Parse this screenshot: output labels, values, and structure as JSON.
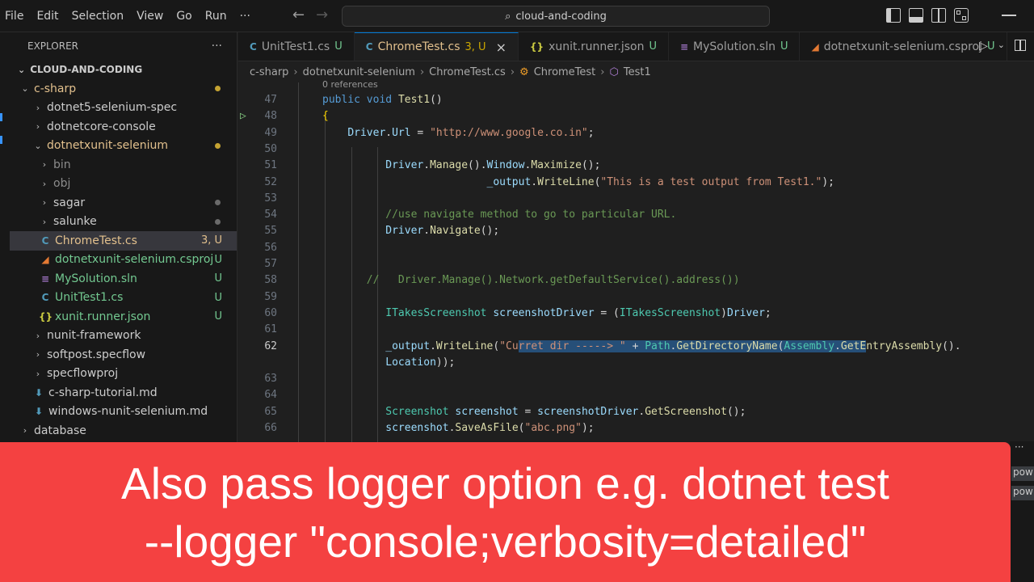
{
  "menu": [
    "File",
    "Edit",
    "Selection",
    "View",
    "Go",
    "Run",
    "···"
  ],
  "search": {
    "text": "cloud-and-coding"
  },
  "explorer": {
    "title": "EXPLORER",
    "more": "···",
    "root": "CLOUD-AND-CODING",
    "items": [
      {
        "label": "c-sharp",
        "indent": 1,
        "chev": "⌄",
        "icon": "",
        "color": "#e2c08d",
        "mark": "dot",
        "markColor": "#c5a332"
      },
      {
        "label": "dotnet5-selenium-spec",
        "indent": 2,
        "chev": "›",
        "icon": "",
        "color": "#cccccc",
        "mark": "",
        "markColor": ""
      },
      {
        "label": "dotnetcore-console",
        "indent": 2,
        "chev": "›",
        "icon": "",
        "color": "#cccccc",
        "mark": "",
        "markColor": ""
      },
      {
        "label": "dotnetxunit-selenium",
        "indent": 2,
        "chev": "⌄",
        "icon": "",
        "color": "#e2c08d",
        "mark": "dot",
        "markColor": "#c5a332"
      },
      {
        "label": "bin",
        "indent": 3,
        "chev": "›",
        "icon": "",
        "color": "#8c8c8c",
        "mark": "",
        "markColor": ""
      },
      {
        "label": "obj",
        "indent": 3,
        "chev": "›",
        "icon": "",
        "color": "#8c8c8c",
        "mark": "",
        "markColor": ""
      },
      {
        "label": "sagar",
        "indent": 3,
        "chev": "›",
        "icon": "",
        "color": "#cccccc",
        "mark": "dot",
        "markColor": "#6a6a6a"
      },
      {
        "label": "salunke",
        "indent": 3,
        "chev": "›",
        "icon": "",
        "color": "#cccccc",
        "mark": "dot",
        "markColor": "#6a6a6a"
      },
      {
        "label": "ChromeTest.cs",
        "indent": 3,
        "chev": "",
        "icon": "C",
        "iconColor": "#519aba",
        "color": "#e2c08d",
        "mark": "3, U",
        "markColor": "#e2c08d",
        "selected": true
      },
      {
        "label": "dotnetxunit-selenium.csproj",
        "indent": 3,
        "chev": "",
        "icon": "◢",
        "iconColor": "#e37933",
        "color": "#73c991",
        "mark": "U",
        "markColor": "#73c991"
      },
      {
        "label": "MySolution.sln",
        "indent": 3,
        "chev": "",
        "icon": "≡",
        "iconColor": "#a074c4",
        "color": "#73c991",
        "mark": "U",
        "markColor": "#73c991"
      },
      {
        "label": "UnitTest1.cs",
        "indent": 3,
        "chev": "",
        "icon": "C",
        "iconColor": "#519aba",
        "color": "#73c991",
        "mark": "U",
        "markColor": "#73c991"
      },
      {
        "label": "xunit.runner.json",
        "indent": 3,
        "chev": "",
        "icon": "{}",
        "iconColor": "#cbcb41",
        "color": "#73c991",
        "mark": "U",
        "markColor": "#73c991"
      },
      {
        "label": "nunit-framework",
        "indent": 2,
        "chev": "›",
        "icon": "",
        "color": "#cccccc",
        "mark": "",
        "markColor": ""
      },
      {
        "label": "softpost.specflow",
        "indent": 2,
        "chev": "›",
        "icon": "",
        "color": "#cccccc",
        "mark": "",
        "markColor": ""
      },
      {
        "label": "specflowproj",
        "indent": 2,
        "chev": "›",
        "icon": "",
        "color": "#cccccc",
        "mark": "",
        "markColor": ""
      },
      {
        "label": "c-sharp-tutorial.md",
        "indent": 2,
        "chev": "",
        "icon": "⬇",
        "iconColor": "#519aba",
        "color": "#cccccc",
        "mark": "",
        "markColor": ""
      },
      {
        "label": "windows-nunit-selenium.md",
        "indent": 2,
        "chev": "",
        "icon": "⬇",
        "iconColor": "#519aba",
        "color": "#cccccc",
        "mark": "",
        "markColor": ""
      },
      {
        "label": "database",
        "indent": 1,
        "chev": "›",
        "icon": "",
        "color": "#cccccc",
        "mark": "",
        "markColor": ""
      }
    ]
  },
  "tabs": [
    {
      "icon": "C",
      "iconColor": "#519aba",
      "label": "UnitTest1.cs",
      "mark": "U",
      "active": false
    },
    {
      "icon": "C",
      "iconColor": "#519aba",
      "label": "ChromeTest.cs",
      "mark": "3, U",
      "active": true
    },
    {
      "icon": "{}",
      "iconColor": "#cbcb41",
      "label": "xunit.runner.json",
      "mark": "U",
      "active": false
    },
    {
      "icon": "≡",
      "iconColor": "#a074c4",
      "label": "MySolution.sln",
      "mark": "U",
      "active": false
    },
    {
      "icon": "◢",
      "iconColor": "#e37933",
      "label": "dotnetxunit-selenium.csproj",
      "mark": "U",
      "active": false
    }
  ],
  "tab_close": "×",
  "breadcrumb": [
    "c-sharp",
    "dotnetxunit-selenium",
    "ChromeTest.cs",
    "ChromeTest",
    "Test1"
  ],
  "code": {
    "references": "0 references",
    "current_line": "62",
    "lines": [
      {
        "n": "47",
        "tokens": [
          [
            "kw",
            "public "
          ],
          [
            "kw",
            "void "
          ],
          [
            "fn",
            "Test1"
          ],
          [
            "pn",
            "()"
          ]
        ]
      },
      {
        "n": "48",
        "tokens": [
          [
            "brace",
            "{"
          ]
        ]
      },
      {
        "n": "49",
        "tokens": [
          [
            "pn",
            "    "
          ],
          [
            "id",
            "Driver"
          ],
          [
            "pn",
            "."
          ],
          [
            "id",
            "Url"
          ],
          [
            "pn",
            " = "
          ],
          [
            "str",
            "\"http://www.google.co.in\""
          ],
          [
            "pn",
            ";"
          ]
        ]
      },
      {
        "n": "50",
        "tokens": []
      },
      {
        "n": "51",
        "tokens": [
          [
            "pn",
            "          "
          ],
          [
            "id",
            "Driver"
          ],
          [
            "pn",
            "."
          ],
          [
            "fn",
            "Manage"
          ],
          [
            "pn",
            "()."
          ],
          [
            "id",
            "Window"
          ],
          [
            "pn",
            "."
          ],
          [
            "fn",
            "Maximize"
          ],
          [
            "pn",
            "();"
          ]
        ]
      },
      {
        "n": "52",
        "tokens": [
          [
            "pn",
            "                          "
          ],
          [
            "id",
            "_output"
          ],
          [
            "pn",
            "."
          ],
          [
            "fn",
            "WriteLine"
          ],
          [
            "pn",
            "("
          ],
          [
            "str",
            "\"This is a test output from Test1.\""
          ],
          [
            "pn",
            ");"
          ]
        ]
      },
      {
        "n": "53",
        "tokens": []
      },
      {
        "n": "54",
        "tokens": [
          [
            "pn",
            "          "
          ],
          [
            "cm",
            "//use navigate method to go to particular URL."
          ]
        ]
      },
      {
        "n": "55",
        "tokens": [
          [
            "pn",
            "          "
          ],
          [
            "id",
            "Driver"
          ],
          [
            "pn",
            "."
          ],
          [
            "fn",
            "Navigate"
          ],
          [
            "pn",
            "();"
          ]
        ]
      },
      {
        "n": "56",
        "tokens": []
      },
      {
        "n": "57",
        "tokens": []
      },
      {
        "n": "58",
        "tokens": [
          [
            "pn",
            "       "
          ],
          [
            "cm",
            "//   Driver.Manage().Network.getDefaultService().address())"
          ]
        ]
      },
      {
        "n": "59",
        "tokens": []
      },
      {
        "n": "60",
        "tokens": [
          [
            "pn",
            "          "
          ],
          [
            "ty",
            "ITakesScreenshot"
          ],
          [
            "pn",
            " "
          ],
          [
            "id",
            "screenshotDriver"
          ],
          [
            "pn",
            " = ("
          ],
          [
            "ty",
            "ITakesScreenshot"
          ],
          [
            "pn",
            ")"
          ],
          [
            "id",
            "Driver"
          ],
          [
            "pn",
            ";"
          ]
        ]
      },
      {
        "n": "61",
        "tokens": []
      },
      {
        "n": "62",
        "tokens": [
          [
            "pn",
            "          "
          ],
          [
            "id",
            "_output"
          ],
          [
            "pn",
            "."
          ],
          [
            "fn",
            "WriteLine"
          ],
          [
            "pn",
            "("
          ],
          [
            "str",
            "\"Cu"
          ],
          [
            "str sel",
            "rret dir -----> \" "
          ],
          [
            "pn sel",
            "+ "
          ],
          [
            "ty sel",
            "Path"
          ],
          [
            "pn sel",
            "."
          ],
          [
            "fn sel",
            "GetDirectoryName"
          ],
          [
            "pn sel",
            "("
          ],
          [
            "ty sel",
            "Assembly"
          ],
          [
            "pn sel",
            "."
          ],
          [
            "fn sel",
            "GetE"
          ],
          [
            "fn",
            "ntryAssembly"
          ],
          [
            "pn",
            "()."
          ]
        ]
      },
      {
        "n": "",
        "tokens": [
          [
            "pn",
            "          "
          ],
          [
            "id",
            "Location"
          ],
          [
            "pn",
            "));"
          ]
        ]
      },
      {
        "n": "63",
        "tokens": []
      },
      {
        "n": "64",
        "tokens": []
      },
      {
        "n": "65",
        "tokens": [
          [
            "pn",
            "          "
          ],
          [
            "ty",
            "Screenshot"
          ],
          [
            "pn",
            " "
          ],
          [
            "id",
            "screenshot"
          ],
          [
            "pn",
            " = "
          ],
          [
            "id",
            "screenshotDriver"
          ],
          [
            "pn",
            "."
          ],
          [
            "fn",
            "GetScreenshot"
          ],
          [
            "pn",
            "();"
          ]
        ]
      },
      {
        "n": "66",
        "tokens": [
          [
            "pn",
            "          "
          ],
          [
            "id",
            "screenshot"
          ],
          [
            "pn",
            "."
          ],
          [
            "fn",
            "SaveAsFile"
          ],
          [
            "pn",
            "("
          ],
          [
            "str",
            "\"abc.png\""
          ],
          [
            "pn",
            ");"
          ]
        ]
      }
    ]
  },
  "panel_tabs": [
    "pow",
    "pow"
  ],
  "caption": {
    "line1": "Also pass logger option e.g. dotnet test",
    "line2": "--logger \"console;verbosity=detailed\""
  }
}
